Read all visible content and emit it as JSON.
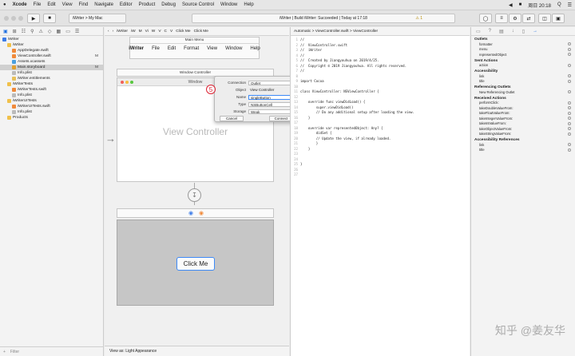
{
  "menubar": {
    "apple": "",
    "items": [
      "Xcode",
      "File",
      "Edit",
      "View",
      "Find",
      "Navigate",
      "Editor",
      "Product",
      "Debug",
      "Source Control",
      "Window",
      "Help"
    ],
    "clock": "周日 20:18",
    "status_icons": [
      "◀",
      "■",
      "Q",
      "☰"
    ]
  },
  "toolbar": {
    "scheme": "iWriter > My Mac",
    "status_text": "iWriter | Build iWriter: Succeeded | Today at 17:18",
    "warning_count": "1"
  },
  "navigator": {
    "tab_icons": [
      "▣",
      "⊞",
      "☷",
      "⚲",
      "⚠",
      "◇",
      "▦",
      "▭",
      "☰"
    ],
    "items": [
      {
        "label": "iWriter",
        "level": 0,
        "badge": "",
        "color": "#3b7be8"
      },
      {
        "label": "iWriter",
        "level": 1,
        "badge": "",
        "color": "#f0c04a"
      },
      {
        "label": "AppDelegate.swift",
        "level": 2,
        "badge": "",
        "color": "#f08a3a"
      },
      {
        "label": "ViewController.swift",
        "level": 2,
        "badge": "M",
        "color": "#f08a3a"
      },
      {
        "label": "Assets.xcassets",
        "level": 2,
        "badge": "",
        "color": "#4aa0e0"
      },
      {
        "label": "Main.storyboard",
        "level": 2,
        "badge": "M",
        "color": "#e0a030",
        "selected": true
      },
      {
        "label": "Info.plist",
        "level": 2,
        "badge": "",
        "color": "#bbbbbb"
      },
      {
        "label": "iWriter.entitlements",
        "level": 2,
        "badge": "",
        "color": "#e7c15a"
      },
      {
        "label": "iWriterTests",
        "level": 1,
        "badge": "",
        "color": "#f0c04a"
      },
      {
        "label": "iWriterTests.swift",
        "level": 2,
        "badge": "",
        "color": "#f08a3a"
      },
      {
        "label": "Info.plist",
        "level": 2,
        "badge": "",
        "color": "#bbbbbb"
      },
      {
        "label": "iWriterUITests",
        "level": 1,
        "badge": "",
        "color": "#f0c04a"
      },
      {
        "label": "iWriterUITests.swift",
        "level": 2,
        "badge": "",
        "color": "#f08a3a"
      },
      {
        "label": "Info.plist",
        "level": 2,
        "badge": "",
        "color": "#bbbbbb"
      },
      {
        "label": "Products",
        "level": 1,
        "badge": "",
        "color": "#f0c04a"
      }
    ],
    "filter_placeholder": "Filter"
  },
  "ib": {
    "jumpbar": [
      "iWriter",
      "iW",
      "M",
      "Vi",
      "W",
      "V",
      "C",
      "V",
      "Click Me",
      "Click Me"
    ],
    "menu_scene_title": "Main Menu",
    "menu_items": [
      "iWriter",
      "File",
      "Edit",
      "Format",
      "View",
      "Window",
      "Help"
    ],
    "window_scene_title": "Window Controller",
    "window_title": "Window",
    "vc_label": "View Controller",
    "button_label": "Click Me",
    "footer": "View as: Light Appearance",
    "step_marker": "5"
  },
  "connection_popup": {
    "connection_label": "Connection",
    "connection_value": "Outlet",
    "object_label": "Object",
    "object_value": "View Controller",
    "name_label": "Name",
    "name_value": "singleButton",
    "type_label": "Type",
    "type_value": "NSButtonCell",
    "storage_label": "Storage",
    "storage_value": "Weak",
    "cancel": "Cancel",
    "connect": "Connect"
  },
  "code": {
    "jumpbar": "Automatic > ViewController.swift > ViewController",
    "lines": [
      {
        "n": "1",
        "t": "//",
        "c": "c-com"
      },
      {
        "n": "2",
        "t": "//  ViewController.swift",
        "c": "c-com"
      },
      {
        "n": "3",
        "t": "//  iWriter",
        "c": "c-com"
      },
      {
        "n": "4",
        "t": "//",
        "c": "c-com"
      },
      {
        "n": "5",
        "t": "//  Created by Jiangyouhua on 2019/4/25.",
        "c": "c-com"
      },
      {
        "n": "6",
        "t": "//  Copyright © 2019 Jiangyouhua. All rights reserved.",
        "c": "c-com"
      },
      {
        "n": "7",
        "t": "//",
        "c": "c-com"
      },
      {
        "n": "8",
        "t": "",
        "c": ""
      },
      {
        "n": "9",
        "t": "import Cocoa",
        "c": "c-kw"
      },
      {
        "n": "10",
        "t": "",
        "c": ""
      },
      {
        "n": "11",
        "t": "class ViewController: NSViewController {",
        "c": "c-ty"
      },
      {
        "n": "12",
        "t": "",
        "c": ""
      },
      {
        "n": "13",
        "t": "    override func viewDidLoad() {",
        "c": "c-kw"
      },
      {
        "n": "14",
        "t": "        super.viewDidLoad()",
        "c": "c-fn"
      },
      {
        "n": "15",
        "t": "        // Do any additional setup after loading the view.",
        "c": "c-com"
      },
      {
        "n": "16",
        "t": "    }",
        "c": ""
      },
      {
        "n": "17",
        "t": "",
        "c": ""
      },
      {
        "n": "18",
        "t": "    override var representedObject: Any? {",
        "c": "c-kw"
      },
      {
        "n": "19",
        "t": "        didSet {",
        "c": "c-kw"
      },
      {
        "n": "20",
        "t": "        // Update the view, if already loaded.",
        "c": "c-com"
      },
      {
        "n": "21",
        "t": "        }",
        "c": ""
      },
      {
        "n": "22",
        "t": "    }",
        "c": ""
      },
      {
        "n": "23",
        "t": "",
        "c": ""
      },
      {
        "n": "24",
        "t": "",
        "c": ""
      },
      {
        "n": "25",
        "t": "}",
        "c": ""
      },
      {
        "n": "26",
        "t": "",
        "c": ""
      },
      {
        "n": "27",
        "t": "",
        "c": ""
      }
    ]
  },
  "inspector": {
    "tab_icons": [
      "▭",
      "?",
      "▤",
      "↓",
      "▯",
      "→"
    ],
    "sections": [
      {
        "title": "Outlets",
        "rows": [
          "formatter",
          "menu",
          "representedObject"
        ]
      },
      {
        "title": "Sent Actions",
        "rows": [
          "action"
        ]
      },
      {
        "title": "Accessibility",
        "rows": [
          "link",
          "title"
        ]
      },
      {
        "title": "Referencing Outlets",
        "rows": [
          "New Referencing Outlet"
        ]
      },
      {
        "title": "Received Actions",
        "rows": [
          "performClick:",
          "takeDoubleValueFrom:",
          "takeFloatValueFrom:",
          "takeIntegerValueFrom:",
          "takeIntValueFrom:",
          "takeObjectValueFrom:",
          "takeStringValueFrom:"
        ]
      },
      {
        "title": "Accessibility References",
        "rows": [
          "link",
          "title"
        ]
      }
    ]
  },
  "watermark": "知乎 @姜友华"
}
